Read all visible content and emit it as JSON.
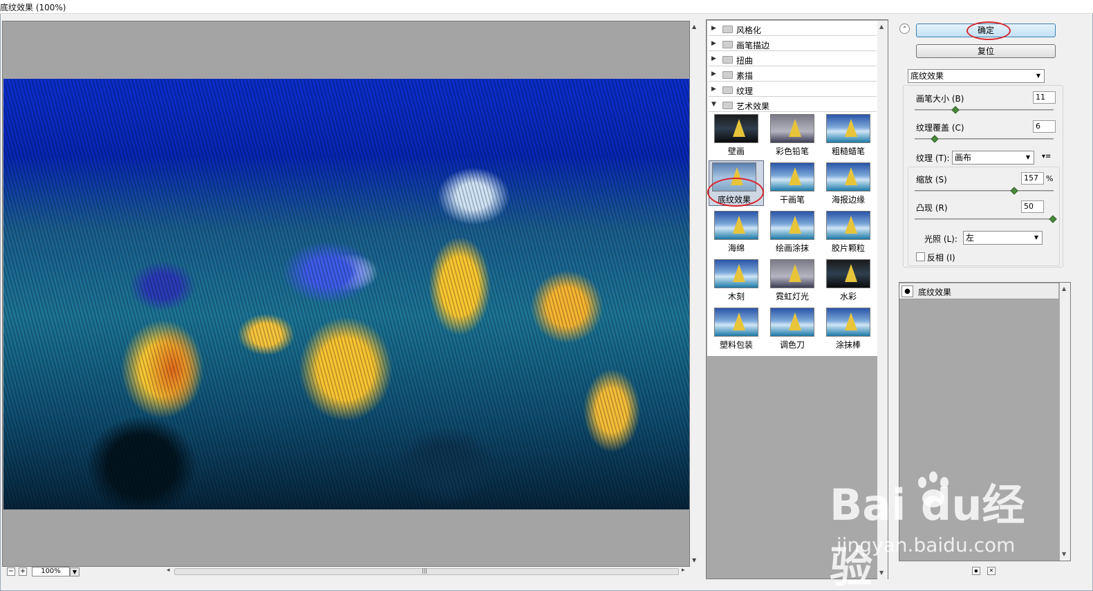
{
  "window": {
    "title": "底纹效果 (100%)"
  },
  "preview": {
    "zoom": "100%",
    "zoom_out": "−",
    "zoom_in": "+",
    "grip": "|||"
  },
  "filter_tree": {
    "categories": [
      {
        "label": "风格化",
        "expanded": false
      },
      {
        "label": "画笔描边",
        "expanded": false
      },
      {
        "label": "扭曲",
        "expanded": false
      },
      {
        "label": "素描",
        "expanded": false
      },
      {
        "label": "纹理",
        "expanded": false
      },
      {
        "label": "艺术效果",
        "expanded": true
      }
    ],
    "thumbnails": [
      {
        "label": "壁画"
      },
      {
        "label": "彩色铅笔"
      },
      {
        "label": "粗糙蜡笔"
      },
      {
        "label": "底纹效果",
        "selected": true
      },
      {
        "label": "干画笔"
      },
      {
        "label": "海报边缘"
      },
      {
        "label": "海绵"
      },
      {
        "label": "绘画涂抹"
      },
      {
        "label": "胶片颗粒"
      },
      {
        "label": "木刻"
      },
      {
        "label": "霓虹灯光"
      },
      {
        "label": "水彩"
      },
      {
        "label": "塑料包装"
      },
      {
        "label": "调色刀"
      },
      {
        "label": "涂抹棒"
      }
    ]
  },
  "controls": {
    "ok_label": "确定",
    "reset_label": "复位",
    "filter_select": "底纹效果",
    "brush_size": {
      "label": "画笔大小 (B)",
      "value": "11",
      "level": 0.3
    },
    "texture_coverage": {
      "label": "纹理覆盖 (C)",
      "value": "6",
      "level": 0.15
    },
    "texture": {
      "label": "纹理 (T):",
      "value": "画布"
    },
    "scaling": {
      "label": "缩放 (S)",
      "value": "157",
      "unit": "%",
      "level": 0.72
    },
    "relief": {
      "label": "凸现 (R)",
      "value": "50",
      "level": 1.0
    },
    "light": {
      "label": "光照 (L):",
      "value": "左"
    },
    "invert": {
      "label": "反相 (I)",
      "checked": false
    }
  },
  "layers": {
    "items": [
      {
        "label": "底纹效果",
        "visible": true
      }
    ]
  },
  "watermark": {
    "logo": "Bai  du经验",
    "url": "jingyan.baidu.com"
  },
  "colors": {
    "accent": "#3c7fb1",
    "highlight": "#d9252b"
  }
}
